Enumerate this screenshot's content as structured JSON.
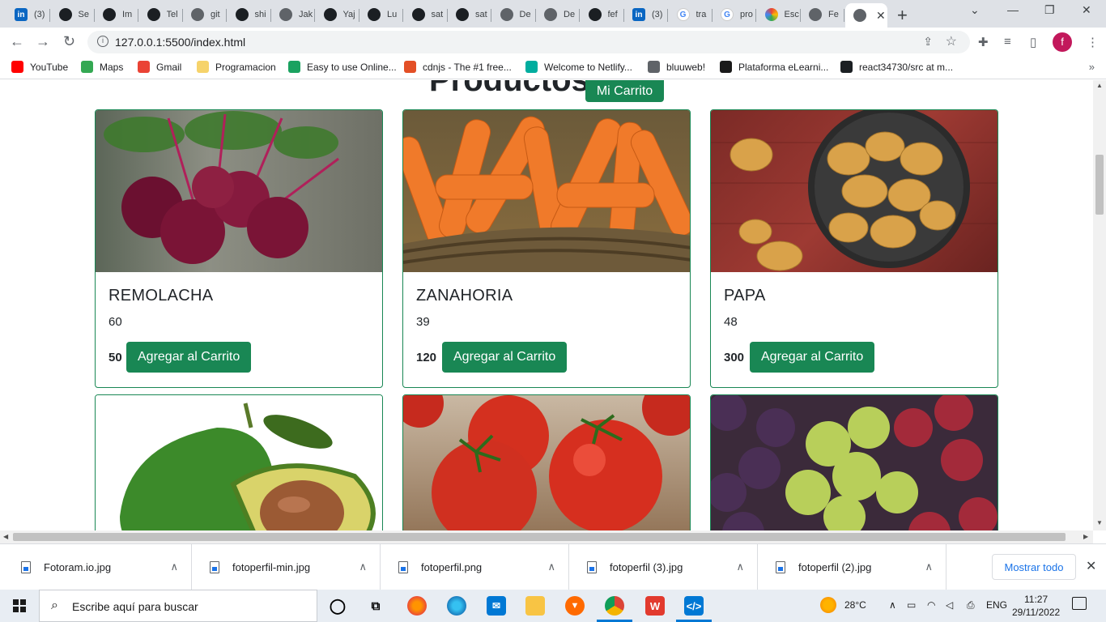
{
  "browser": {
    "tabs": [
      {
        "icon": "linkedin-icon",
        "label": "(3)"
      },
      {
        "icon": "github-icon",
        "label": "Se"
      },
      {
        "icon": "github-icon",
        "label": "Im"
      },
      {
        "icon": "github-icon",
        "label": "Tel"
      },
      {
        "icon": "globe-icon",
        "label": "git"
      },
      {
        "icon": "github-icon",
        "label": "shi"
      },
      {
        "icon": "globe-icon",
        "label": "Jak"
      },
      {
        "icon": "github-icon",
        "label": "Yaj"
      },
      {
        "icon": "github-icon",
        "label": "Lu"
      },
      {
        "icon": "github-icon",
        "label": "sat"
      },
      {
        "icon": "github-icon",
        "label": "sat"
      },
      {
        "icon": "globe-icon",
        "label": "De"
      },
      {
        "icon": "globe-icon",
        "label": "De"
      },
      {
        "icon": "github-icon",
        "label": "fef"
      },
      {
        "icon": "linkedin-icon",
        "label": "(3)"
      },
      {
        "icon": "google-icon",
        "label": "tra"
      },
      {
        "icon": "google-icon",
        "label": "pro"
      },
      {
        "icon": "ring-icon",
        "label": "Esc"
      },
      {
        "icon": "globe-icon",
        "label": "Fe"
      }
    ],
    "active_tab": {
      "icon": "globe-icon",
      "close": "✕"
    },
    "new_tab": "+",
    "url": "127.0.0.1:5500/index.html",
    "profile_initial": "f",
    "bookmarks": [
      {
        "label": "YouTube",
        "icon": "youtube-icon",
        "color": "#ff0000"
      },
      {
        "label": "Maps",
        "icon": "maps-icon",
        "color": "#34a853"
      },
      {
        "label": "Gmail",
        "icon": "gmail-icon",
        "color": "#ea4335"
      },
      {
        "label": "Programacion",
        "icon": "folder-icon",
        "color": "#f6d36b"
      },
      {
        "label": "Easy to use Online...",
        "icon": "easy-icon",
        "color": "#1aa260"
      },
      {
        "label": "cdnjs - The #1 free...",
        "icon": "cdnjs-icon",
        "color": "#e34f26"
      },
      {
        "label": "Welcome to Netlify...",
        "icon": "netlify-icon",
        "color": "#00ad9f"
      },
      {
        "label": "bluuweb!",
        "icon": "globe-icon",
        "color": "#5f6368"
      },
      {
        "label": "Plataforma eLearni...",
        "icon": "elearning-icon",
        "color": "#1a1a1a"
      },
      {
        "label": "react34730/src at m...",
        "icon": "github-icon",
        "color": "#1b1f23"
      }
    ],
    "bookmarks_more": "»"
  },
  "page": {
    "title": "Productos",
    "cart_button": "Mi Carrito",
    "products": [
      {
        "name": "REMOLACHA",
        "price": "60",
        "qty": "50",
        "button": "Agregar al Carrito",
        "image": "beet-image"
      },
      {
        "name": "ZANAHORIA",
        "price": "39",
        "qty": "120",
        "button": "Agregar al Carrito",
        "image": "carrot-image"
      },
      {
        "name": "PAPA",
        "price": "48",
        "qty": "300",
        "button": "Agregar al Carrito",
        "image": "potato-image"
      },
      {
        "image": "avocado-image"
      },
      {
        "image": "tomato-image"
      },
      {
        "image": "grape-image"
      }
    ],
    "accent_color": "#198754"
  },
  "downloads": {
    "items": [
      "Fotoram.io.jpg",
      "fotoperfil-min.jpg",
      "fotoperfil.png",
      "fotoperfil (3).jpg",
      "fotoperfil (2).jpg"
    ],
    "show_all": "Mostrar todo"
  },
  "taskbar": {
    "search_placeholder": "Escribe aquí para buscar",
    "temperature": "28°C",
    "language": "ENG",
    "time": "11:27",
    "date": "29/11/2022"
  }
}
